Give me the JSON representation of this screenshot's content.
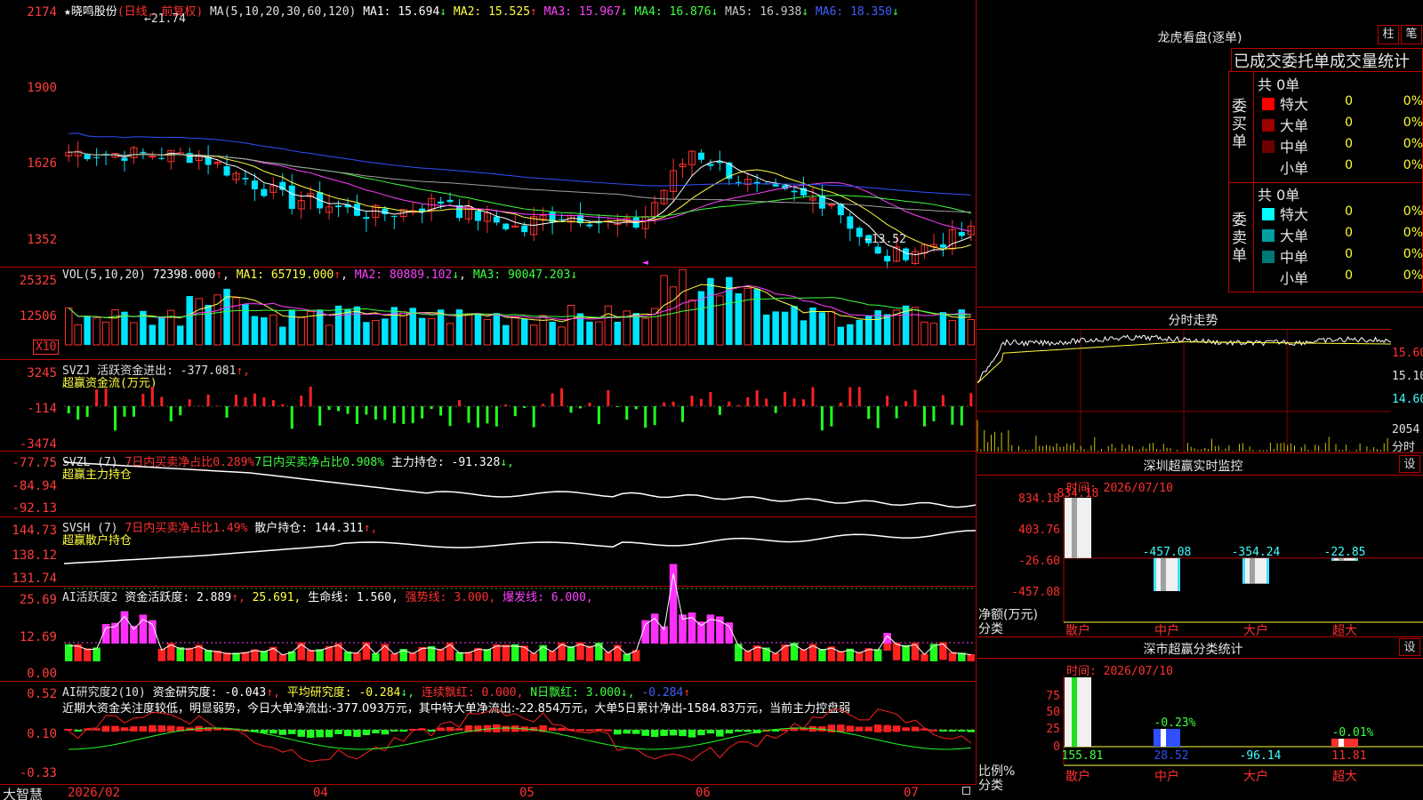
{
  "stock": {
    "name": "晓鸣股份",
    "star": "★",
    "mode": "(日线, 前复权)",
    "ma_label": "MA(5,10,20,30,60,120)",
    "ma": [
      {
        "label": "MA1:",
        "value": "15.694",
        "arrow": "↓",
        "color": "#ffffff"
      },
      {
        "label": "MA2:",
        "value": "15.525",
        "arrow": "↑",
        "color": "#ffff40"
      },
      {
        "label": "MA3:",
        "value": "15.967",
        "arrow": "↓",
        "color": "#ff40ff"
      },
      {
        "label": "MA4:",
        "value": "16.876",
        "arrow": "↓",
        "color": "#40ff40"
      },
      {
        "label": "MA5:",
        "value": "16.938",
        "arrow": "↓",
        "color": "#c8c8c8"
      },
      {
        "label": "MA6:",
        "value": "18.350",
        "arrow": "↓",
        "color": "#4060ff"
      }
    ],
    "high_mark": "←21.74",
    "low_mark": "←13.52",
    "price_axis": [
      "2174",
      "1900",
      "1626",
      "1352"
    ]
  },
  "vol": {
    "header": "VOL(5,10,20)",
    "value": "72398.000",
    "arrow": "↑",
    "ma1": "MA1: 65719.000",
    "ma1_arrow": "↑",
    "ma2": "MA2: 80889.102",
    "ma2_arrow": "↓",
    "ma3": "MA3: 90047.203",
    "ma3_arrow": "↓",
    "axis": [
      "25325",
      "12506"
    ],
    "unit": "X10"
  },
  "svzj": {
    "header": "SVZJ  活跃资金进出: -377.081",
    "arrow": "↑,",
    "sub": "超赢资金流(万元)",
    "axis": [
      "3245",
      "-114",
      "-3474"
    ]
  },
  "svzl": {
    "name": "SVZL (7)",
    "t1": "7日内买卖净占比0.289%",
    "t2": "7日内买卖净占比0.908%",
    "t3": "主力持仓: -91.328",
    "arrow": "↓,",
    "sub": "超赢主力持仓",
    "axis": [
      "-77.75",
      "-84.94",
      "-92.13"
    ]
  },
  "svsh": {
    "name": "SVSH (7)",
    "t1": "7日内买卖净占比1.49%",
    "t2": "散户持仓: 144.311",
    "arrow": "↑,",
    "sub": "超赢散户持仓",
    "axis": [
      "144.73",
      "138.12",
      "131.74"
    ]
  },
  "ai1": {
    "name": "AI活跃度2",
    "t1": "资金活跃度: 2.889",
    "a1": "↑,",
    "t2": "25.691,",
    "t3": "生命线: 1.560,",
    "t4": "强势线: 3.000,",
    "t5": "爆发线: 6.000,",
    "axis": [
      "25.69",
      "12.69",
      "0.00"
    ]
  },
  "ai2": {
    "name": "AI研究度2(10)",
    "t1": "资金研究度: -0.043",
    "a1": "↑,",
    "t2": "平均研究度: -0.284",
    "a2": "↓,",
    "t3": "连续飘红: 0.000,",
    "t4": "N日飘红: 3.000",
    "a4": "↓,",
    "t5": "-0.284",
    "a5": "↑",
    "note": "近期大资金关注度较低，明显弱势，今日大单净流出:-377.093万元，其中特大单净流出:-22.854万元，大单5日累计净出-1584.83万元，当前主力控盘弱",
    "axis": [
      "0.52",
      "0.10",
      "-0.33"
    ]
  },
  "bottom": {
    "brand": "大智慧",
    "dates": [
      "2026/02",
      "04",
      "05",
      "06",
      "07"
    ]
  },
  "longhu": {
    "title": "龙虎看盘(逐单)",
    "btn1": "柱",
    "btn2": "笔",
    "subtitle": "已成交委托单成交量统计",
    "buy_label": "委买单",
    "sell_label": "委卖单",
    "buy_total": "共 0单",
    "sell_total": "共 0单",
    "buy_rows": [
      {
        "name": "特大",
        "color": "#ff0000",
        "n": "0",
        "p": "0%"
      },
      {
        "name": "大单",
        "color": "#a00000",
        "n": "0",
        "p": "0%"
      },
      {
        "name": "中单",
        "color": "#6e0000",
        "n": "0",
        "p": "0%"
      },
      {
        "name": "小单",
        "color": "",
        "n": "0",
        "p": "0%"
      }
    ],
    "sell_rows": [
      {
        "name": "特大",
        "color": "#00ffff",
        "n": "0",
        "p": "0%"
      },
      {
        "name": "大单",
        "color": "#00a0a0",
        "n": "0",
        "p": "0%"
      },
      {
        "name": "中单",
        "color": "#007878",
        "n": "0",
        "p": "0%"
      },
      {
        "name": "小单",
        "color": "",
        "n": "0",
        "p": "0%"
      }
    ]
  },
  "intraday": {
    "title": "分时走势",
    "axis": [
      "15.60",
      "15.10",
      "14.60",
      "2054"
    ],
    "vol_label": "分时"
  },
  "sz_monitor": {
    "title": "深圳超赢实时监控",
    "btn": "设",
    "time": "时间: 2026/07/10",
    "axis": [
      "834.18",
      "403.76",
      "-26.60",
      "-457.08"
    ],
    "ylabel": "净额(万元)",
    "xlabel": "分类",
    "categories": [
      "散户",
      "中户",
      "大户",
      "超大"
    ],
    "values": [
      "834.18",
      "-457.08",
      "-354.24",
      "-22.85"
    ]
  },
  "sz_class": {
    "title": "深市超赢分类统计",
    "btn": "设",
    "time": "时间: 2026/07/10",
    "axis": [
      "75",
      "50",
      "25",
      "0"
    ],
    "ylabel": "比例%",
    "xlabel": "分类",
    "categories": [
      "散户",
      "中户",
      "大户",
      "超大"
    ],
    "pct": [
      "",
      "-0.23%",
      "",
      "-0.01%"
    ],
    "values": [
      "155.81",
      "28.52",
      "-96.14",
      "11.81"
    ]
  },
  "chart_data": {
    "type": "bar",
    "title": "深圳超赢实时监控",
    "categories": [
      "散户",
      "中户",
      "大户",
      "超大"
    ],
    "values": [
      834.18,
      -457.08,
      -354.24,
      -22.85
    ],
    "ylabel": "净额(万元)",
    "xlabel": "分类",
    "ylim": [
      -457.08,
      834.18
    ]
  }
}
